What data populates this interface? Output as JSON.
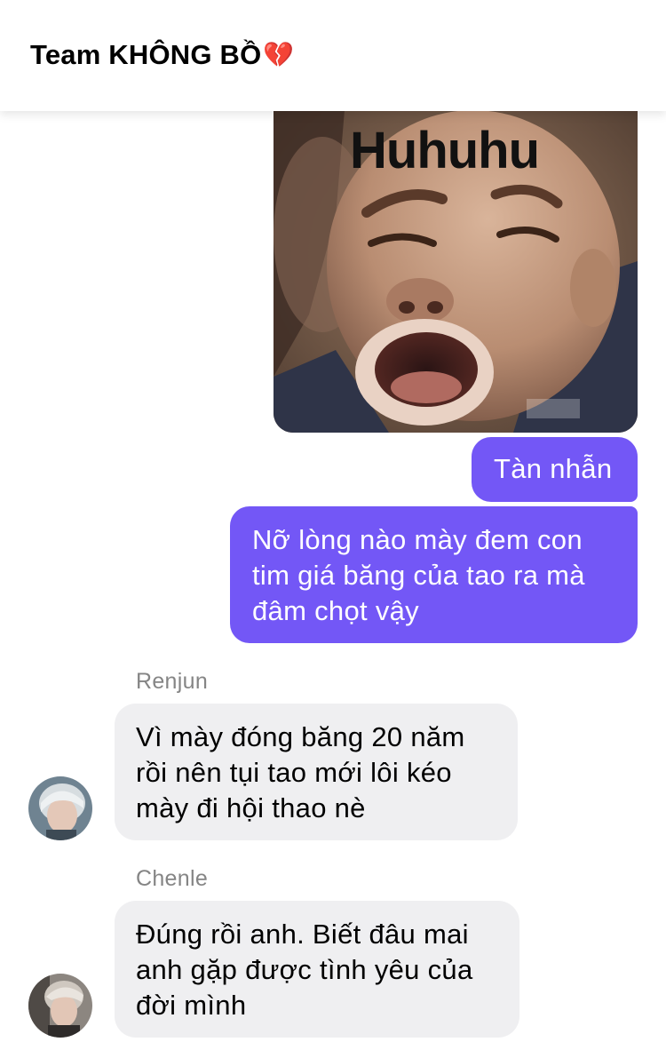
{
  "header": {
    "title": "Team KHÔNG BỒ",
    "emoji": "💔",
    "emoji_icon": "broken-heart-icon"
  },
  "sticker": {
    "caption": "Huhuhu",
    "icon": "crying-face-meme-image"
  },
  "messages": {
    "out_1": "Tàn nhẫn",
    "out_2": {
      "lines": [
        "Nỡ lòng nào mày đem con",
        "tim giá băng của tao ra mà",
        "đâm chọt vậy"
      ]
    },
    "renjun": {
      "sender": "Renjun",
      "lines": [
        "Vì mày đóng băng 20 năm",
        "rồi nên tụi tao mới lôi kéo",
        "mày đi hội thao nè"
      ]
    },
    "chenle": {
      "sender": "Chenle",
      "lines": [
        "Đúng rồi anh. Biết đâu mai",
        "anh gặp được tình yêu của",
        "đời mình"
      ]
    }
  },
  "colors": {
    "outgoing_bubble": "#7357f6",
    "incoming_bubble": "#efeff1",
    "sender_name": "#858585"
  }
}
